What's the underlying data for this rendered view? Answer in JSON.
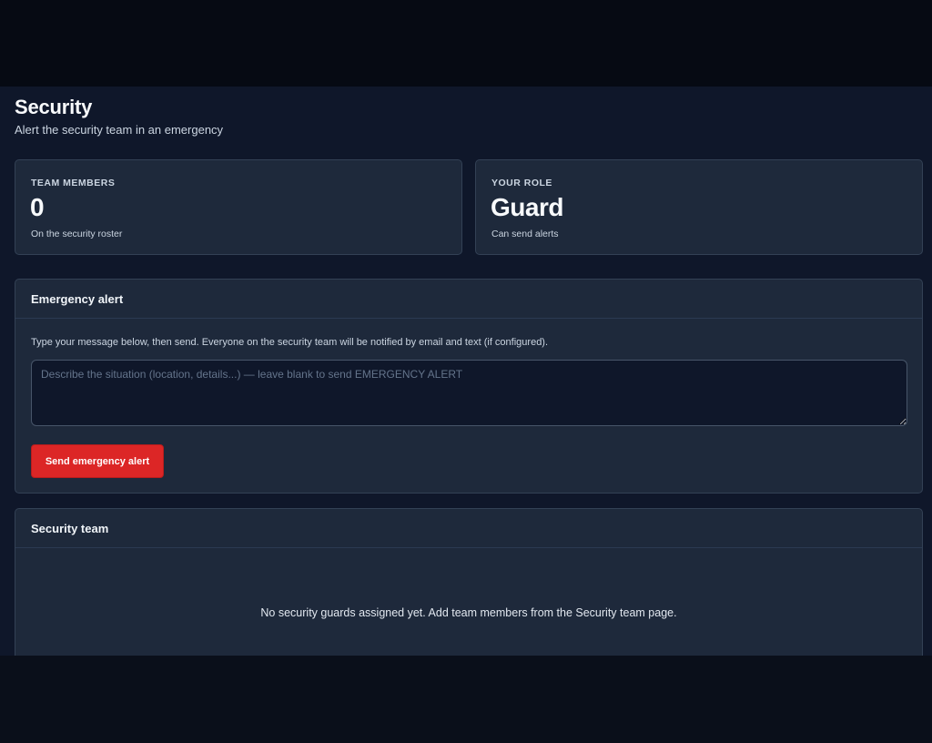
{
  "page": {
    "title": "Security",
    "subtitle": "Alert the security team in an emergency"
  },
  "stats": [
    {
      "label": "TEAM MEMBERS",
      "value": "0",
      "note": "On the security roster"
    },
    {
      "label": "YOUR ROLE",
      "value": "Guard",
      "note": "Can send alerts"
    }
  ],
  "alert_panel": {
    "title": "Emergency alert",
    "description": "Type your message below, then send. Everyone on the security team will be notified by email and text (if configured).",
    "message_value": "",
    "message_placeholder": "Describe the situation (location, details...) — leave blank to send EMERGENCY ALERT",
    "send_label": "Send emergency alert"
  },
  "team_panel": {
    "title": "Security team",
    "empty_message": "No security guards assigned yet. Add team members from the Security team page."
  },
  "colors": {
    "background": "#0f172a",
    "card": "#1e293b",
    "danger": "#dc2626"
  }
}
